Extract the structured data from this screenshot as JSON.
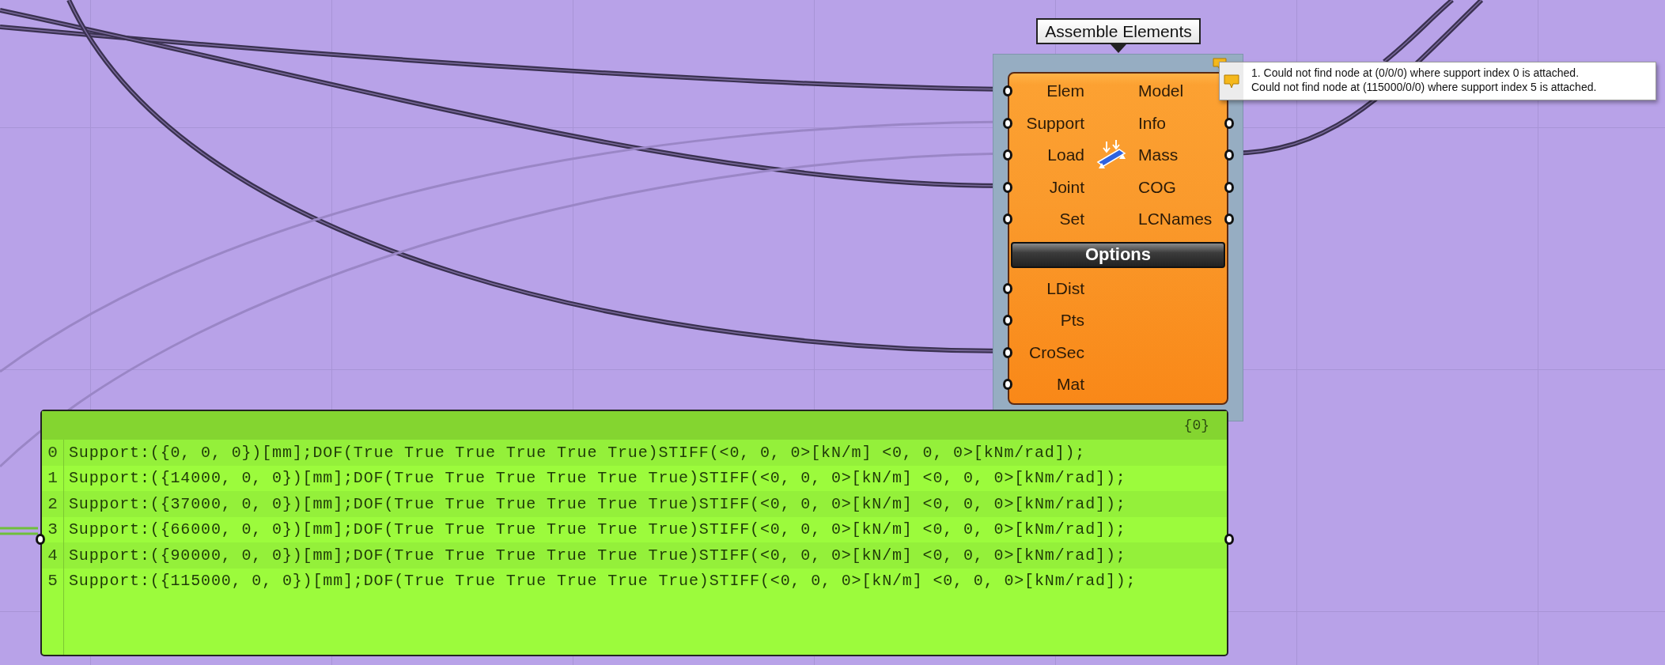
{
  "component": {
    "title": "Assemble Elements",
    "inputs": [
      "Elem",
      "Support",
      "Load",
      "Joint",
      "Set"
    ],
    "outputs": [
      "Model",
      "Info",
      "Mass",
      "COG",
      "LCNames"
    ],
    "options_label": "Options",
    "option_inputs": [
      "LDist",
      "Pts",
      "CroSec",
      "Mat"
    ]
  },
  "warning": {
    "lines": [
      "1. Could not find node at (0/0/0) where support index 0 is attached.",
      "Could not find node at (115000/0/0) where support index 5 is attached."
    ]
  },
  "panel": {
    "path": "{0}",
    "rows": [
      {
        "index": "0",
        "text": "Support:({0, 0, 0})[mm];DOF(True True True True True True)STIFF(<0, 0, 0>[kN/m] <0, 0, 0>[kNm/rad]);"
      },
      {
        "index": "1",
        "text": "Support:({14000, 0, 0})[mm];DOF(True True True True True True)STIFF(<0, 0, 0>[kN/m] <0, 0, 0>[kNm/rad]);"
      },
      {
        "index": "2",
        "text": "Support:({37000, 0, 0})[mm];DOF(True True True True True True)STIFF(<0, 0, 0>[kN/m] <0, 0, 0>[kNm/rad]);"
      },
      {
        "index": "3",
        "text": "Support:({66000, 0, 0})[mm];DOF(True True True True True True)STIFF(<0, 0, 0>[kN/m] <0, 0, 0>[kNm/rad]);"
      },
      {
        "index": "4",
        "text": "Support:({90000, 0, 0})[mm];DOF(True True True True True True)STIFF(<0, 0, 0>[kN/m] <0, 0, 0>[kNm/rad]);"
      },
      {
        "index": "5",
        "text": "Support:({115000, 0, 0})[mm];DOF(True True True True True True)STIFF(<0, 0, 0>[kN/m] <0, 0, 0>[kNm/rad]);"
      }
    ]
  }
}
